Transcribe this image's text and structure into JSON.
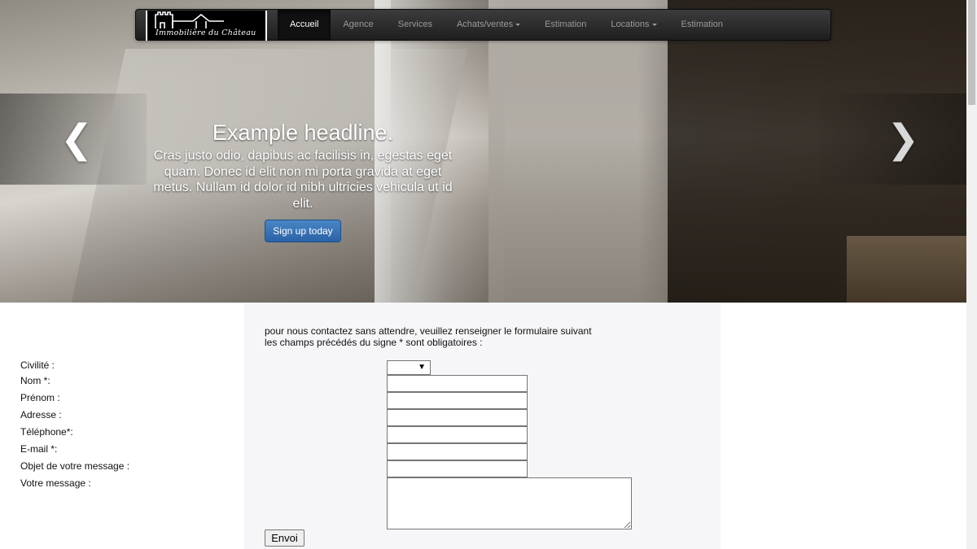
{
  "brand": {
    "name": "Immobilière du Château"
  },
  "nav": {
    "items": [
      {
        "label": "Accueil",
        "active": true,
        "dropdown": false
      },
      {
        "label": "Agence",
        "active": false,
        "dropdown": false
      },
      {
        "label": "Services",
        "active": false,
        "dropdown": false
      },
      {
        "label": "Achats/ventes",
        "active": false,
        "dropdown": true
      },
      {
        "label": "Estimation",
        "active": false,
        "dropdown": false
      },
      {
        "label": "Locations",
        "active": false,
        "dropdown": true
      },
      {
        "label": "Estimation",
        "active": false,
        "dropdown": false
      }
    ]
  },
  "carousel": {
    "headline": "Example headline.",
    "text": "Cras justo odio, dapibus ac facilisis in, egestas eget quam. Donec id elit non mi porta gravida at eget metus. Nullam id dolor id nibh ultricies vehicula ut id elit.",
    "button_label": "Sign up today",
    "prev_glyph": "❮",
    "next_glyph": "❯",
    "button_color": "#2a62a6"
  },
  "form": {
    "intro_line1": "pour nous contactez sans attendre, veuillez renseigner le formulaire suivant",
    "intro_line2": "les champs précédés du signe * sont obligatoires :",
    "civilite_label": "Civilité :",
    "nom_label": "Nom *:",
    "prenom_label": "Prénom :",
    "adresse_label": "Adresse :",
    "telephone_label": "Téléphone*:",
    "email_label": "E-mail *:",
    "objet_label": "Objet de votre message :",
    "message_label": "Votre message :",
    "civilite_value": "",
    "nom_value": "",
    "prenom_value": "",
    "adresse_value": "",
    "telephone_value": "",
    "email_value": "",
    "objet_value": "",
    "message_value": "",
    "submit_label": "Envoi"
  },
  "icons": {
    "castle": "castle-logo-icon",
    "select_arrow": "▼"
  }
}
